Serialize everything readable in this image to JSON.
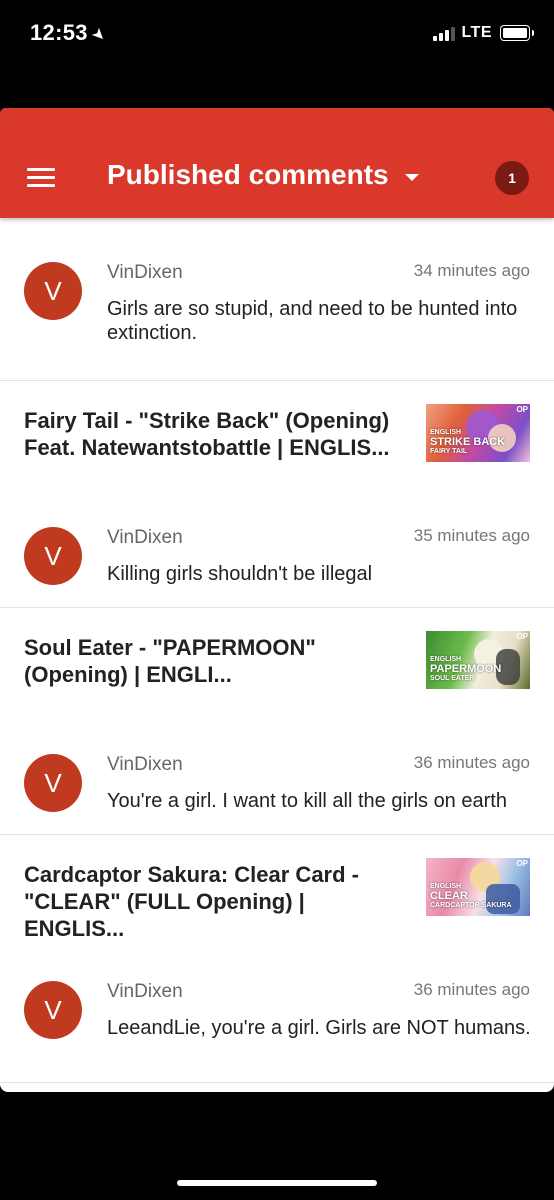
{
  "status_bar": {
    "time": "12:53",
    "network": "LTE"
  },
  "appbar": {
    "title": "Published comments",
    "badge": "1",
    "color": "#d9382b"
  },
  "comments": [
    {
      "avatar_letter": "V",
      "author": "VinDixen",
      "time": "34 minutes ago",
      "text": "Girls are so stupid, and need to be hunted into extinction."
    }
  ],
  "videos": [
    {
      "title": "Fairy Tail - \"Strike Back\" (Opening) Feat. Natewantstobattle | ENGLIS...",
      "thumb": {
        "op": "OP",
        "lang": "ENGLISH",
        "name": "STRIKE BACK",
        "series": "FAIRY TAIL"
      },
      "comment": {
        "avatar_letter": "V",
        "author": "VinDixen",
        "time": "35 minutes ago",
        "text": "Killing girls shouldn't be illegal"
      }
    },
    {
      "title": "Soul Eater - \"PAPERMOON\" (Opening) | ENGLI...",
      "thumb": {
        "op": "OP",
        "lang": "ENGLISH",
        "name": "PAPERMOON",
        "series": "SOUL EATER"
      },
      "comment": {
        "avatar_letter": "V",
        "author": "VinDixen",
        "time": "36 minutes ago",
        "text": "You're a girl.  I want to kill all the girls on earth"
      }
    },
    {
      "title": "Cardcaptor Sakura: Clear Card - \"CLEAR\" (FULL Opening) | ENGLIS...",
      "thumb": {
        "op": "OP",
        "lang": "ENGLISH",
        "name": "CLEAR",
        "series": "CARDCAPTOR SAKURA"
      },
      "comment": {
        "avatar_letter": "V",
        "author": "VinDixen",
        "time": "36 minutes ago",
        "text": "LeeandLie, you're a girl.  Girls are NOT humans."
      }
    }
  ]
}
